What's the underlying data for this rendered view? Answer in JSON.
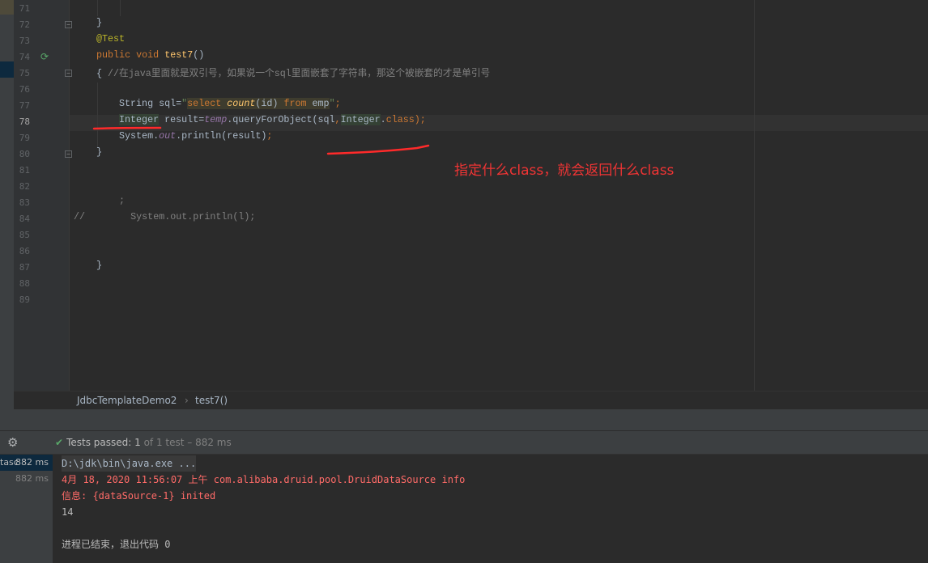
{
  "editor": {
    "line_numbers": [
      "71",
      "72",
      "73",
      "74",
      "75",
      "76",
      "77",
      "78",
      "79",
      "80",
      "81",
      "82",
      "83",
      "84",
      "85",
      "86",
      "87",
      "88",
      "89"
    ],
    "current_line": "78",
    "lines": [
      {
        "n": "71",
        "indent": 0,
        "tokens": []
      },
      {
        "n": "72",
        "indent": 4,
        "tokens": [
          {
            "t": "}",
            "c": ""
          }
        ]
      },
      {
        "n": "73",
        "indent": 4,
        "tokens": [
          {
            "t": "@Test",
            "c": "ann"
          }
        ]
      },
      {
        "n": "74",
        "indent": 4,
        "tokens": [
          {
            "t": "public ",
            "c": "kw"
          },
          {
            "t": "void ",
            "c": "kw"
          },
          {
            "t": "test7",
            "c": "fn"
          },
          {
            "t": "()",
            "c": ""
          }
        ]
      },
      {
        "n": "75",
        "indent": 4,
        "tokens": [
          {
            "t": "{ ",
            "c": ""
          },
          {
            "t": "//在java里面就是双引号，如果说一个sql里面嵌套了字符串，那这个被嵌套的才是单引号",
            "c": "cm"
          }
        ]
      },
      {
        "n": "76",
        "indent": 0,
        "tokens": []
      },
      {
        "n": "77",
        "indent": 8,
        "tokens": [
          {
            "t": "String sql=",
            "c": ""
          },
          {
            "t": "\"",
            "c": "str"
          },
          {
            "t": "select ",
            "c": "sql"
          },
          {
            "t": "count",
            "c": "sqlfn"
          },
          {
            "t": "(id) ",
            "c": "sqlp"
          },
          {
            "t": "from ",
            "c": "sql"
          },
          {
            "t": "emp",
            "c": "sqlp"
          },
          {
            "t": "\"",
            "c": "str"
          },
          {
            "t": ";",
            "c": "kw"
          }
        ]
      },
      {
        "n": "78",
        "indent": 8,
        "tokens": [
          {
            "t": "Integer",
            "c": "hl"
          },
          {
            "t": " result=",
            "c": ""
          },
          {
            "t": "temp",
            "c": "field"
          },
          {
            "t": ".queryForObject(sql",
            "c": ""
          },
          {
            "t": ",",
            "c": "kw"
          },
          {
            "t": "Integer",
            "c": "hl"
          },
          {
            "t": ".",
            "c": ""
          },
          {
            "t": "class",
            "c": "kw"
          },
          {
            "t": ");",
            "c": "kw"
          }
        ]
      },
      {
        "n": "79",
        "indent": 8,
        "tokens": [
          {
            "t": "System.",
            "c": ""
          },
          {
            "t": "out",
            "c": "field"
          },
          {
            "t": ".println(result)",
            "c": ""
          },
          {
            "t": ";",
            "c": "kw"
          }
        ]
      },
      {
        "n": "80",
        "indent": 4,
        "tokens": [
          {
            "t": "}",
            "c": ""
          }
        ]
      },
      {
        "n": "81",
        "indent": 0,
        "tokens": []
      },
      {
        "n": "82",
        "indent": 0,
        "tokens": []
      },
      {
        "n": "83",
        "indent": 8,
        "tokens": [
          {
            "t": ";",
            "c": "cm"
          }
        ]
      },
      {
        "n": "84",
        "indent": 0,
        "tokens": [
          {
            "t": "//        System.out.println(l);",
            "c": "cm"
          }
        ]
      },
      {
        "n": "85",
        "indent": 0,
        "tokens": []
      },
      {
        "n": "86",
        "indent": 0,
        "tokens": []
      },
      {
        "n": "87",
        "indent": 4,
        "tokens": [
          {
            "t": "}",
            "c": ""
          }
        ]
      },
      {
        "n": "88",
        "indent": 0,
        "tokens": []
      },
      {
        "n": "89",
        "indent": 0,
        "tokens": []
      }
    ],
    "annotation": "指定什么class，就会返回什么class",
    "annotation_color": "#f03434"
  },
  "breadcrumb": {
    "class": "JdbcTemplateDemo2",
    "separator": "›",
    "method": "test7()"
  },
  "run": {
    "status_label": "Tests passed:",
    "passed": "1",
    "of_text": "of 1 test – 882 ms",
    "tree": [
      {
        "label": "tasc",
        "time": "882 ms"
      },
      {
        "label": "",
        "time": "882 ms"
      }
    ],
    "console": [
      {
        "text": "D:\\jdk\\bin\\java.exe ...",
        "color": "#a9b7c6",
        "bg": "#3a3a3a"
      },
      {
        "text": "4月 18, 2020 11:56:07 上午 com.alibaba.druid.pool.DruidDataSource info",
        "color": "#ff6b68"
      },
      {
        "text": "信息: {dataSource-1} inited",
        "color": "#ff6b68"
      },
      {
        "text": "14",
        "color": "#bbbbbb"
      },
      {
        "text": "",
        "color": "#bbbbbb"
      },
      {
        "text": "进程已结束，退出代码 0",
        "color": "#bbbbbb"
      }
    ]
  }
}
